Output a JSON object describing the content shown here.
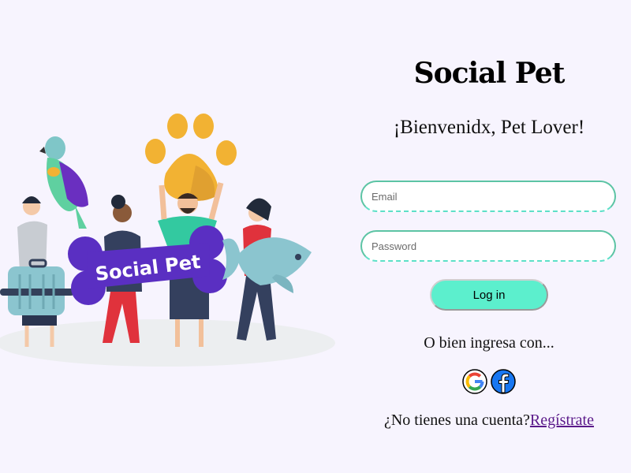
{
  "brand": {
    "title": "Social Pet"
  },
  "illustration": {
    "bone_text": "Social Pet"
  },
  "welcome": {
    "text": "¡Bienvenidx, Pet Lover!"
  },
  "form": {
    "email": {
      "placeholder": "Email",
      "value": ""
    },
    "password": {
      "placeholder": "Password",
      "value": ""
    },
    "login_label": "Log in"
  },
  "alt_login": {
    "text": "O bien ingresa con...",
    "providers": [
      {
        "name": "google-icon"
      },
      {
        "name": "facebook-icon"
      }
    ]
  },
  "signup": {
    "prompt": "¿No tienes una cuenta?",
    "link": "Regístrate"
  },
  "colors": {
    "background": "#f7f4fe",
    "accent": "#5cefcd",
    "field_border": "#5cc4a4",
    "link": "#5b1a8a",
    "bone": "#5a2fc2",
    "paw": "#f2b233"
  }
}
